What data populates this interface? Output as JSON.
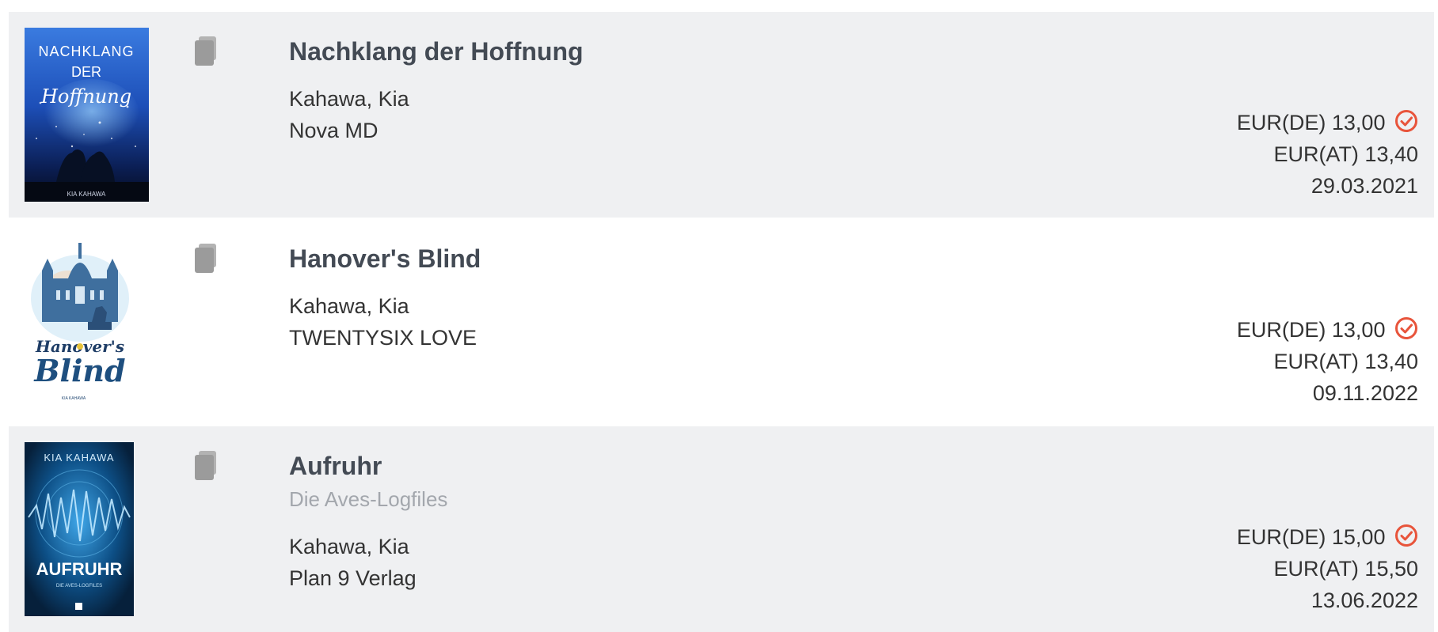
{
  "books": [
    {
      "title": "Nachklang der Hoffnung",
      "subtitle": "",
      "author": "Kahawa, Kia",
      "publisher": "Nova MD",
      "price_de": "EUR(DE) 13,00",
      "price_at": "EUR(AT) 13,40",
      "date": "29.03.2021",
      "cover": {
        "line1": "NACHKLANG",
        "line2": "DER",
        "line3": "Hoffnung",
        "footer": "KIA KAHAWA"
      },
      "icons": {
        "format": "book-icon",
        "availability": "check-circle-icon"
      }
    },
    {
      "title": "Hanover's Blind",
      "subtitle": "",
      "author": "Kahawa, Kia",
      "publisher": "TWENTYSIX LOVE",
      "price_de": "EUR(DE) 13,00",
      "price_at": "EUR(AT) 13,40",
      "date": "09.11.2022",
      "cover": {
        "line1": "Hanover's",
        "line2": "Blind",
        "footer": "KIA KAHAWA"
      },
      "icons": {
        "format": "book-icon",
        "availability": "check-circle-icon"
      }
    },
    {
      "title": "Aufruhr",
      "subtitle": "Die Aves-Logfiles",
      "author": "Kahawa, Kia",
      "publisher": "Plan 9 Verlag",
      "price_de": "EUR(DE) 15,00",
      "price_at": "EUR(AT) 15,50",
      "date": "13.06.2022",
      "cover": {
        "line1": "KIA KAHAWA",
        "line2": "AUFRUHR",
        "footer": "DIE AVES-LOGFILES"
      },
      "icons": {
        "format": "book-icon",
        "availability": "check-circle-icon"
      }
    }
  ],
  "colors": {
    "row_shade": "#eff0f2",
    "title": "#434a54",
    "subtitle": "#a3a7ad",
    "check": "#e8543b",
    "icon": "#9b9b9b"
  }
}
